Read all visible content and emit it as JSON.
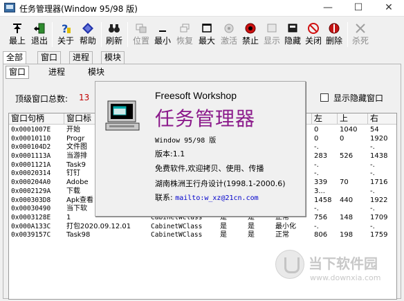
{
  "window": {
    "title": "任务管理器(Window 95/98 版)"
  },
  "titlebar": {
    "min_glyph": "—",
    "max_glyph": "☐",
    "close_glyph": "✕"
  },
  "toolbar": {
    "items": [
      {
        "label": "最上",
        "icon": "pin-icon",
        "disabled": false
      },
      {
        "label": "退出",
        "icon": "exit-door-icon",
        "disabled": false
      },
      {
        "label": "关于",
        "icon": "help-question-icon",
        "disabled": false
      },
      {
        "label": "帮助",
        "icon": "help-book-icon",
        "disabled": false
      },
      {
        "label": "刷新",
        "icon": "binoculars-icon",
        "disabled": false
      },
      {
        "label": "位置",
        "icon": "position-icon",
        "disabled": true
      },
      {
        "label": "最小",
        "icon": "minimize-icon",
        "disabled": false
      },
      {
        "label": "恢复",
        "icon": "restore-icon",
        "disabled": true
      },
      {
        "label": "最大",
        "icon": "maximize-icon",
        "disabled": false
      },
      {
        "label": "激活",
        "icon": "activate-icon",
        "disabled": true
      },
      {
        "label": "禁止",
        "icon": "disable-icon",
        "disabled": false
      },
      {
        "label": "显示",
        "icon": "show-icon",
        "disabled": true
      },
      {
        "label": "隐藏",
        "icon": "hide-icon",
        "disabled": false
      },
      {
        "label": "关闭",
        "icon": "close-circle-icon",
        "disabled": false
      },
      {
        "label": "删除",
        "icon": "delete-icon",
        "disabled": false
      },
      {
        "label": "杀死",
        "icon": "kill-icon",
        "disabled": true
      }
    ]
  },
  "tabs_top": [
    {
      "label": "全部",
      "active": true
    },
    {
      "label": "窗口",
      "active": false
    },
    {
      "label": "进程",
      "active": false
    },
    {
      "label": "模块",
      "active": false
    }
  ],
  "tabs_sub": [
    {
      "label": "窗口",
      "active": true
    },
    {
      "label": "进程",
      "active": false
    },
    {
      "label": "模块",
      "active": false
    }
  ],
  "summary": {
    "label": "顶级窗口总数:",
    "count": "13",
    "show_hidden_label": "显示隐藏窗口"
  },
  "table": {
    "columns": [
      "窗口句柄",
      "窗口标",
      "",
      "",
      "",
      "",
      "左",
      "上",
      "右"
    ],
    "rows": [
      {
        "handle": "0x0001007E",
        "title": "开始",
        "cls": "",
        "c4": "",
        "c5": "",
        "c6": "",
        "left": "0",
        "top": "1040",
        "right": "54"
      },
      {
        "handle": "0x00010110",
        "title": "Progr",
        "cls": "",
        "c4": "",
        "c5": "",
        "c6": "",
        "left": "0",
        "top": "0",
        "right": "1920"
      },
      {
        "handle": "0x000104D2",
        "title": "文件图",
        "cls": "",
        "c4": "",
        "c5": "",
        "c6": "",
        "left": "-.",
        "top": "",
        "right": "-."
      },
      {
        "handle": "0x0001113A",
        "title": "当游排",
        "cls": "",
        "c4": "",
        "c5": "",
        "c6": "",
        "left": "283",
        "top": "526",
        "right": "1438"
      },
      {
        "handle": "0x0001121A",
        "title": "Task9",
        "cls": "",
        "c4": "",
        "c5": "",
        "c6": "",
        "left": "-.",
        "top": "",
        "right": "-."
      },
      {
        "handle": "0x00020314",
        "title": "钉钉",
        "cls": "",
        "c4": "",
        "c5": "",
        "c6": "",
        "left": "-.",
        "top": "",
        "right": "-."
      },
      {
        "handle": "0x000204A0",
        "title": "Adobe",
        "cls": "",
        "c4": "",
        "c5": "",
        "c6": "",
        "left": "339",
        "top": "70",
        "right": "1716"
      },
      {
        "handle": "0x0002129A",
        "title": "下载",
        "cls": "",
        "c4": "",
        "c5": "",
        "c6": "",
        "left": "3...",
        "top": "",
        "right": "-."
      },
      {
        "handle": "0x000303D8",
        "title": "Apk查看",
        "cls": "",
        "c4": "",
        "c5": "",
        "c6": "",
        "left": "1458",
        "top": "440",
        "right": "1922"
      },
      {
        "handle": "0x00030490",
        "title": "当下软",
        "cls": "",
        "c4": "",
        "c5": "",
        "c6": "",
        "left": "-.",
        "top": "",
        "right": "-."
      },
      {
        "handle": "0x0003128E",
        "title": "1",
        "cls": "CabinetWClass",
        "c4": "是",
        "c5": "是",
        "c6": "正常",
        "left": "756",
        "top": "148",
        "right": "1709"
      },
      {
        "handle": "0x000A133C",
        "title": "打包2020.09.12.01",
        "cls": "CabinetWClass",
        "c4": "是",
        "c5": "是",
        "c6": "最小化",
        "left": "-.",
        "top": "",
        "right": "-."
      },
      {
        "handle": "0x0039157C",
        "title": "Task98",
        "cls": "CabinetWClass",
        "c4": "是",
        "c5": "是",
        "c6": "正常",
        "left": "806",
        "top": "198",
        "right": "1759"
      }
    ]
  },
  "about": {
    "company": "Freesoft Workshop",
    "product": "任务管理器",
    "platform": "Window 95/98 版",
    "version": "版本:1.1",
    "license": "免费软件,欢迎拷贝、使用、传播",
    "author": "湖南株洲王行舟设计(1998.1-2000.6)",
    "contact_label": "联系:",
    "contact_link": "mailto:w_xz@21cn.com"
  },
  "watermark": {
    "brand": "当下软件园",
    "url": "www.downxia.com"
  },
  "colors": {
    "title_purple": "#8b1a8b",
    "count_red": "#c00000",
    "link_blue": "#0000cc"
  }
}
